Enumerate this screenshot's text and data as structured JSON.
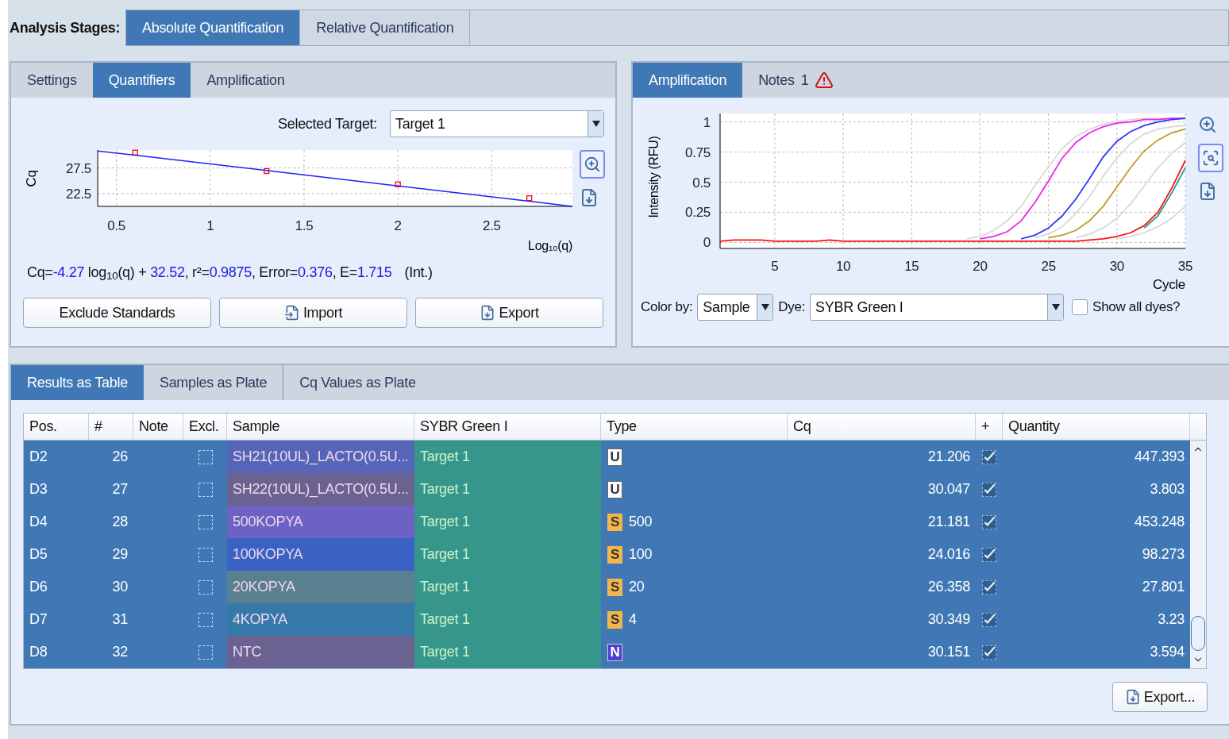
{
  "analysis_stages": {
    "label": "Analysis Stages:",
    "tabs": [
      {
        "label": "Absolute Quantification",
        "selected": true
      },
      {
        "label": "Relative Quantification",
        "selected": false
      }
    ]
  },
  "left_panel": {
    "tabs": [
      {
        "label": "Settings",
        "selected": false
      },
      {
        "label": "Quantifiers",
        "selected": true
      },
      {
        "label": "Amplification",
        "selected": false
      }
    ],
    "selected_target_label": "Selected Target:",
    "selected_target": "Target 1",
    "chart_data": {
      "type": "scatter",
      "ylabel": "Cq",
      "xlabel": "Log₁₀(q)",
      "x": [
        0.4,
        0.6,
        1.3,
        2.0,
        2.7,
        2.93
      ],
      "xlim": [
        0.4,
        2.93
      ],
      "ylim": [
        20,
        31
      ],
      "xticks": [
        0.5,
        1,
        1.5,
        2,
        2.5
      ],
      "yticks": [
        22.5,
        27.5
      ],
      "grid": true,
      "series": [
        {
          "color": "#ff0000",
          "values": [
            null,
            30.5,
            26.9,
            24.3,
            21.6,
            null
          ]
        },
        {
          "type": "line",
          "color": "#2020ff",
          "values": [
            30.8,
            30.0,
            27.0,
            24.0,
            21.0,
            20.0
          ]
        }
      ]
    },
    "equation": [
      {
        "text": "Cq=",
        "highlight": false
      },
      {
        "text": "-4.27",
        "highlight": true
      },
      {
        "text": " log$_{10}$(q) + ",
        "highlight": false
      },
      {
        "text": "32.52",
        "highlight": true
      },
      {
        "text": ", r²=",
        "highlight": false
      },
      {
        "text": "0.9875",
        "highlight": true
      },
      {
        "text": ", Error=",
        "highlight": false
      },
      {
        "text": "0.376",
        "highlight": true
      },
      {
        "text": ", E=",
        "highlight": false
      },
      {
        "text": "1.715",
        "highlight": true
      }
    ],
    "equation_note": "(Int.)",
    "buttons": [
      {
        "label": "Exclude Standards",
        "kind": "plain"
      },
      {
        "label": "Import",
        "kind": "import"
      },
      {
        "label": "Export",
        "kind": "export"
      }
    ]
  },
  "right_panel": {
    "tabs": [
      {
        "label": "Amplification",
        "selected": true
      },
      {
        "label": "Notes",
        "selected": false
      }
    ],
    "notes_count": "1",
    "chart_data": {
      "type": "line",
      "xlabel": "Cycle",
      "ylabel": "Intensity (RFU)",
      "x": [
        1,
        2,
        3,
        4,
        5,
        6,
        7,
        8,
        9,
        10,
        11,
        12,
        13,
        14,
        15,
        16,
        17,
        18,
        19,
        20,
        21,
        22,
        23,
        24,
        25,
        26,
        27,
        28,
        29,
        30,
        31,
        32,
        33,
        34,
        35
      ],
      "xlim": [
        1,
        35
      ],
      "ylim": [
        -0.05,
        1.07
      ],
      "xticks": [
        5,
        10,
        15,
        20,
        25,
        30,
        35
      ],
      "yticks": [
        0,
        0.25,
        0.5,
        0.75,
        1
      ],
      "grid": true,
      "series": [
        {
          "color": "#d8d8d8",
          "values": [
            null,
            null,
            null,
            null,
            null,
            null,
            null,
            null,
            null,
            null,
            null,
            null,
            null,
            null,
            null,
            null,
            null,
            null,
            0.03,
            0.05,
            0.1,
            0.18,
            0.3,
            0.47,
            0.63,
            0.78,
            0.88,
            0.94,
            0.98,
            1.0,
            1.02,
            1.03,
            1.03,
            1.03,
            1.03
          ]
        },
        {
          "color": "#d8d8d8",
          "values": [
            null,
            null,
            null,
            null,
            null,
            null,
            null,
            null,
            null,
            null,
            null,
            null,
            null,
            null,
            null,
            null,
            null,
            null,
            null,
            null,
            null,
            null,
            null,
            0.04,
            0.07,
            0.13,
            0.24,
            0.38,
            0.55,
            0.7,
            0.82,
            0.9,
            0.94,
            0.96,
            0.97
          ]
        },
        {
          "color": "#d8d8d8",
          "values": [
            null,
            null,
            null,
            null,
            null,
            null,
            null,
            null,
            null,
            null,
            null,
            null,
            null,
            null,
            null,
            null,
            null,
            null,
            null,
            null,
            null,
            null,
            null,
            null,
            null,
            null,
            0.04,
            0.07,
            0.12,
            0.2,
            0.32,
            0.47,
            0.62,
            0.74,
            0.83
          ]
        },
        {
          "color": "#d8d8d8",
          "values": [
            null,
            null,
            null,
            null,
            null,
            null,
            null,
            null,
            null,
            null,
            null,
            null,
            null,
            null,
            null,
            null,
            null,
            null,
            null,
            null,
            null,
            null,
            null,
            null,
            null,
            null,
            null,
            null,
            null,
            0.03,
            0.05,
            0.08,
            0.13,
            0.2,
            0.3
          ]
        },
        {
          "color": "#ee22ee",
          "values": [
            null,
            null,
            null,
            null,
            null,
            null,
            null,
            null,
            null,
            null,
            null,
            null,
            null,
            null,
            null,
            null,
            null,
            null,
            null,
            0.03,
            0.05,
            0.09,
            0.18,
            0.33,
            0.51,
            0.7,
            0.83,
            0.91,
            0.96,
            0.99,
            1.0,
            1.02,
            1.02,
            1.03,
            1.03
          ]
        },
        {
          "color": "#2a3cf0",
          "values": [
            null,
            null,
            null,
            null,
            null,
            null,
            null,
            null,
            null,
            null,
            null,
            null,
            null,
            null,
            null,
            null,
            null,
            null,
            null,
            null,
            null,
            null,
            0.03,
            0.06,
            0.12,
            0.22,
            0.36,
            0.53,
            0.71,
            0.84,
            0.92,
            0.97,
            1.0,
            1.02,
            1.03
          ]
        },
        {
          "color": "#c09a20",
          "values": [
            null,
            null,
            null,
            null,
            null,
            null,
            null,
            null,
            null,
            null,
            null,
            null,
            null,
            null,
            null,
            null,
            null,
            null,
            null,
            null,
            null,
            null,
            null,
            null,
            0.04,
            0.06,
            0.1,
            0.18,
            0.3,
            0.46,
            0.62,
            0.76,
            0.85,
            0.91,
            0.94
          ]
        },
        {
          "color": "#1a9a8a",
          "values": [
            null,
            null,
            null,
            null,
            null,
            null,
            null,
            null,
            null,
            null,
            null,
            null,
            null,
            null,
            null,
            null,
            null,
            null,
            null,
            null,
            null,
            null,
            null,
            null,
            null,
            null,
            null,
            null,
            null,
            null,
            null,
            0.12,
            0.22,
            0.41,
            0.62
          ]
        },
        {
          "color": "#ff1010",
          "values": [
            0.01,
            0.02,
            0.02,
            0.02,
            0.01,
            0.01,
            0.01,
            0.01,
            0.02,
            0.01,
            0.01,
            0.01,
            0.01,
            0.01,
            0.01,
            0.01,
            0.01,
            0.01,
            0.01,
            0.01,
            0.01,
            0.01,
            0.01,
            0.01,
            0.01,
            0.01,
            0.01,
            0.02,
            0.03,
            0.05,
            0.08,
            0.14,
            0.25,
            0.45,
            0.68
          ]
        }
      ]
    },
    "color_by_label": "Color by:",
    "color_by": "Sample",
    "dye_label": "Dye:",
    "dye": "SYBR Green I",
    "show_all_dyes": {
      "label": "Show all dyes?",
      "checked": false
    }
  },
  "results": {
    "tabs": [
      {
        "label": "Results as Table",
        "selected": true
      },
      {
        "label": "Samples as Plate",
        "selected": false
      },
      {
        "label": "Cq Values as Plate",
        "selected": false
      }
    ],
    "table": {
      "columns": [
        "Pos.",
        "#",
        "Note",
        "Excl.",
        "Sample",
        "SYBR Green I",
        "Type",
        "Cq",
        "+",
        "Quantity"
      ],
      "rows": [
        {
          "pos": "D2",
          "num": "26",
          "excluded": false,
          "sample": "SH21(10UL)_LACTO(0.5U...",
          "color": "#5566b8",
          "target": "Target 1",
          "kind": "unknown",
          "type_code": "U",
          "cq": "21.206",
          "included": true,
          "quantity": "447.393",
          "selected": true
        },
        {
          "pos": "D3",
          "num": "27",
          "excluded": false,
          "sample": "SH22(10UL)_LACTO(0.5U...",
          "color": "#6a6290",
          "target": "Target 1",
          "kind": "unknown",
          "type_code": "U",
          "cq": "30.047",
          "included": true,
          "quantity": "3.803",
          "selected": true
        },
        {
          "pos": "D4",
          "num": "28",
          "excluded": false,
          "sample": "500KOPYA",
          "color": "#6b62c4",
          "target": "Target 1",
          "kind": "standard",
          "type_code": "S",
          "type_value": "500",
          "cq": "21.181",
          "included": true,
          "quantity": "453.248",
          "selected": true
        },
        {
          "pos": "D5",
          "num": "29",
          "excluded": false,
          "sample": "100KOPYA",
          "color": "#3a62c4",
          "target": "Target 1",
          "kind": "standard",
          "type_code": "S",
          "type_value": "100",
          "cq": "24.016",
          "included": true,
          "quantity": "98.273",
          "selected": true
        },
        {
          "pos": "D6",
          "num": "30",
          "excluded": false,
          "sample": "20KOPYA",
          "color": "#5a7f8f",
          "target": "Target 1",
          "kind": "standard",
          "type_code": "S",
          "type_value": "20",
          "cq": "26.358",
          "included": true,
          "quantity": "27.801",
          "selected": true
        },
        {
          "pos": "D7",
          "num": "31",
          "excluded": false,
          "sample": "4KOPYA",
          "color": "#3579a8",
          "target": "Target 1",
          "kind": "standard",
          "type_code": "S",
          "type_value": "4",
          "cq": "30.349",
          "included": true,
          "quantity": "3.23",
          "selected": true
        },
        {
          "pos": "D8",
          "num": "32",
          "excluded": false,
          "sample": "NTC",
          "color": "#6a6290",
          "target": "Target 1",
          "kind": "ntc",
          "type_code": "N",
          "cq": "30.151",
          "included": true,
          "quantity": "3.594",
          "selected": true
        }
      ]
    },
    "export_button": "Export..."
  }
}
